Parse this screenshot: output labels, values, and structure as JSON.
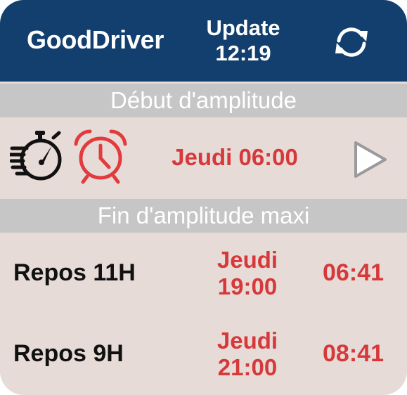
{
  "header": {
    "title": "GoodDriver",
    "update_label": "Update",
    "update_time": "12:19",
    "refresh_icon": "refresh-icon"
  },
  "start_section": {
    "title": "Début d'amplitude",
    "value": "Jeudi 06:00",
    "icons": [
      "stopwatch-icon",
      "alarm-clock-icon",
      "play-icon"
    ]
  },
  "end_section": {
    "title": "Fin d'amplitude maxi",
    "rows": [
      {
        "label": "Repos 11H",
        "day": "Jeudi",
        "time": "19:00",
        "remaining": "06:41"
      },
      {
        "label": "Repos 9H",
        "day": "Jeudi",
        "time": "21:00",
        "remaining": "08:41"
      }
    ]
  },
  "colors": {
    "header_bg": "#123f6e",
    "band_bg": "#c6c6c6",
    "body_bg": "#e7dbd8",
    "accent_red": "#d7383a"
  }
}
